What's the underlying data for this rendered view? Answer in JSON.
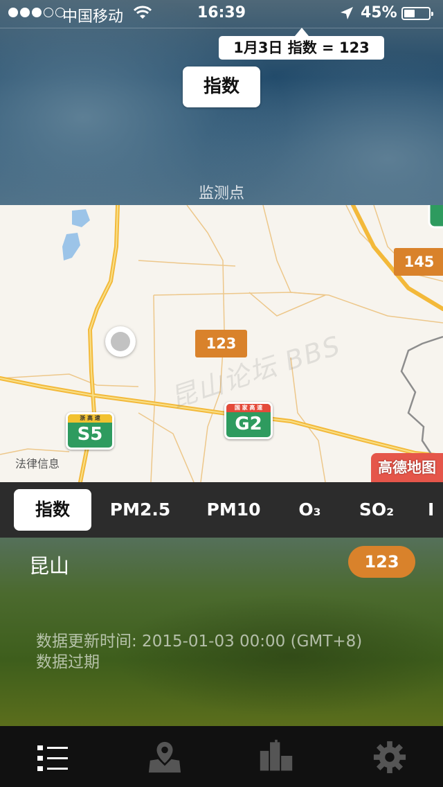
{
  "status_bar": {
    "signal": [
      true,
      true,
      true,
      false,
      false
    ],
    "carrier": "中国移动",
    "time": "16:39",
    "battery_percent": "45%",
    "battery_level": 0.45,
    "icons": [
      "wifi-icon",
      "location-arrow-icon",
      "battery-icon"
    ]
  },
  "header": {
    "tooltip": "1月3日 指数 = 123",
    "metric_chip": "指数",
    "stations_label": "监测点"
  },
  "map": {
    "markers": [
      {
        "value": "123",
        "color": "#d9822b"
      },
      {
        "value": "145",
        "color": "#d9822b"
      }
    ],
    "highway_shields": [
      {
        "code": "S5",
        "band_text": "浙 高 速",
        "band_color": "#f2c230"
      },
      {
        "code": "G2",
        "band_text": "国 家 高 速",
        "band_color": "#e44a3a"
      }
    ],
    "legal_link": "法律信息",
    "brand": "高德地图",
    "watermark": "昆山论坛 BBS"
  },
  "tabs": [
    {
      "label": "指数",
      "active": true
    },
    {
      "label": "PM2.5",
      "active": false
    },
    {
      "label": "PM10",
      "active": false
    },
    {
      "label": "O₃",
      "active": false
    },
    {
      "label": "SO₂",
      "active": false
    },
    {
      "label": "I",
      "active": false
    }
  ],
  "city_panel": {
    "city": "昆山",
    "value": "123",
    "updated": "数据更新时间: 2015-01-03 00:00 (GMT+8)",
    "status": "数据过期"
  },
  "bottom_nav": [
    {
      "icon": "list-icon",
      "active": true
    },
    {
      "icon": "map-pin-icon",
      "active": false
    },
    {
      "icon": "city-buildings-icon",
      "active": false
    },
    {
      "icon": "gear-icon",
      "active": false
    }
  ],
  "colors": {
    "aqi_moderate": "#d9822b",
    "highway_green": "#2e9b5f",
    "road_yellow": "#f6c343"
  }
}
